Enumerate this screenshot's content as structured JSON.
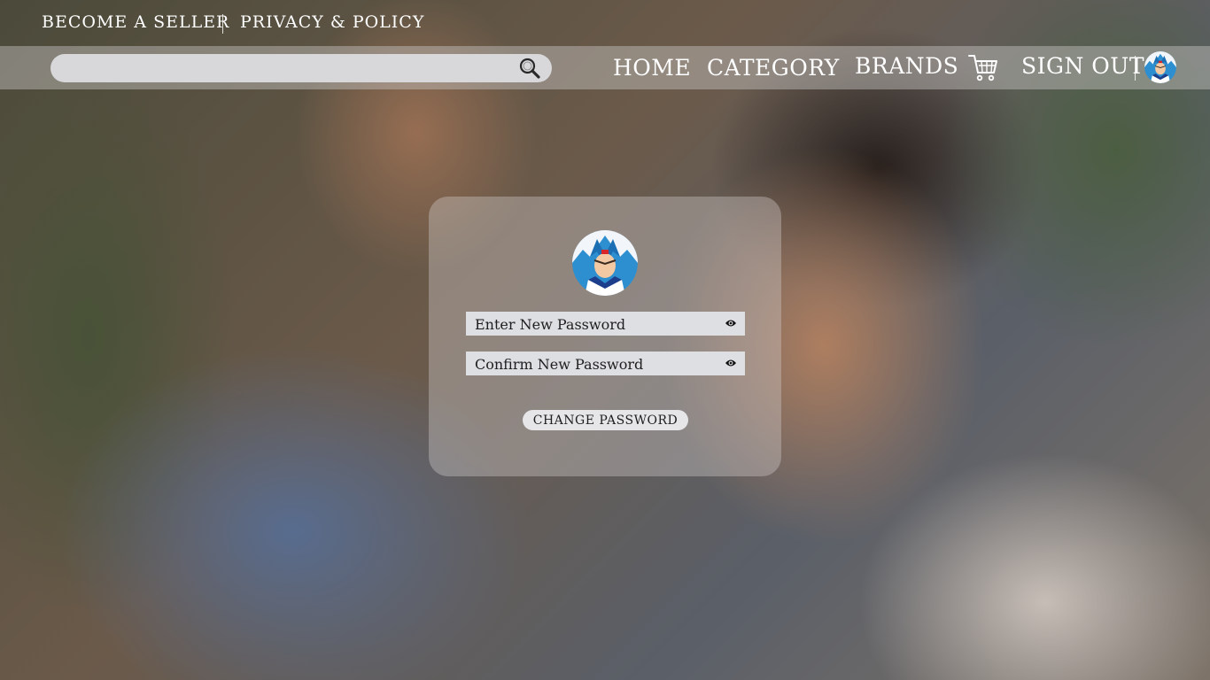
{
  "topbar": {
    "become_seller": "BECOME A SELLER",
    "privacy_policy": "PRIVACY & POLICY"
  },
  "navbar": {
    "search_placeholder": "",
    "search_icon": "search-icon",
    "links": {
      "home": "HOME",
      "category": "CATEGORY",
      "brands": "BRANDS",
      "sign_out": "SIGN OUT"
    },
    "cart_icon": "cart-icon",
    "avatar": "user-avatar"
  },
  "form": {
    "avatar": "profile-avatar",
    "new_password_placeholder": "Enter New Password",
    "confirm_password_placeholder": "Confirm New Password",
    "toggle_visibility_icon": "eye-icon",
    "submit_label": "CHANGE PASSWORD"
  },
  "colors": {
    "navbar_bg": "#c8c6c4",
    "field_bg": "#dedfe3",
    "button_bg": "#e6e6e8",
    "text_light": "#ffffff",
    "text_dark": "#1e1e1e"
  }
}
